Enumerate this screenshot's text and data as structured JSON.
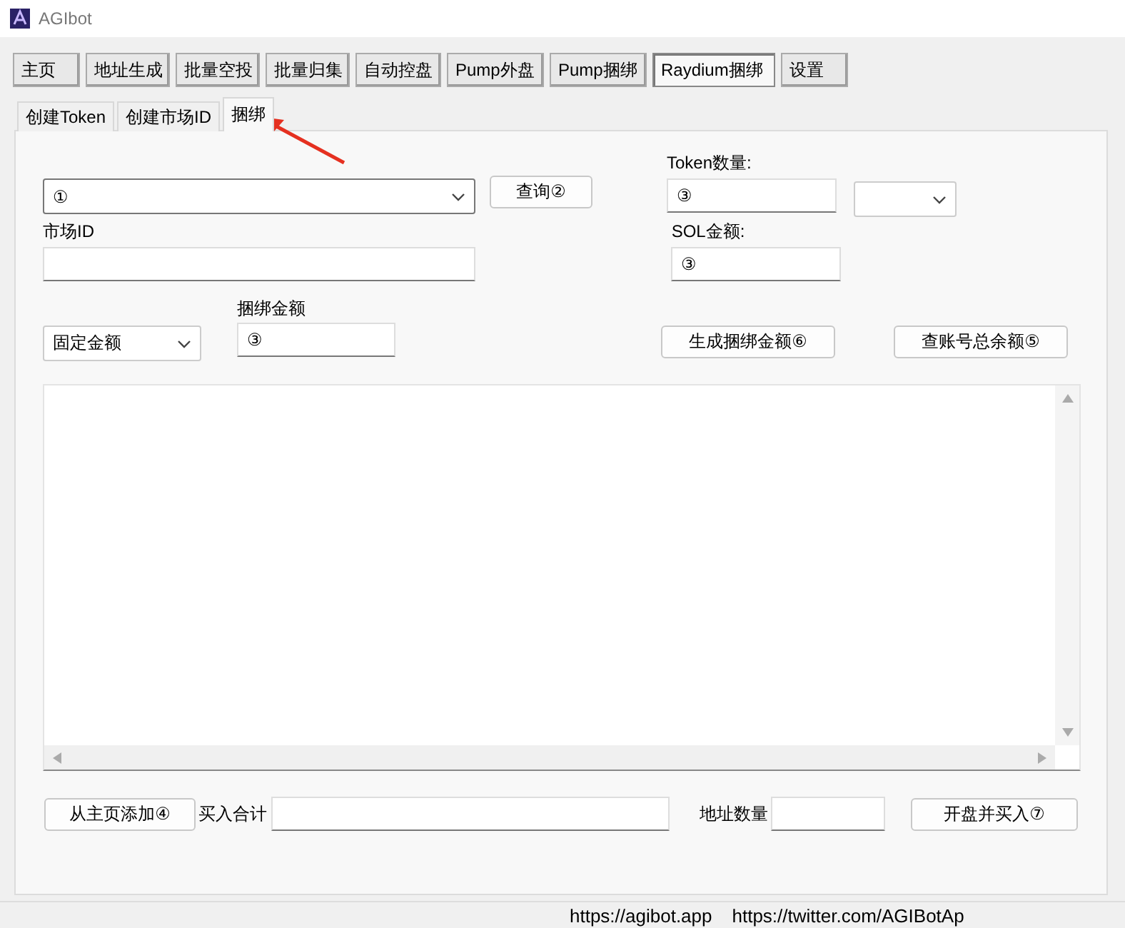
{
  "window": {
    "title": "AGIbot"
  },
  "main_tabs": [
    {
      "label": "主页",
      "selected": false
    },
    {
      "label": "地址生成",
      "selected": false
    },
    {
      "label": "批量空投",
      "selected": false
    },
    {
      "label": "批量归集",
      "selected": false
    },
    {
      "label": "自动控盘",
      "selected": false
    },
    {
      "label": "Pump外盘",
      "selected": false
    },
    {
      "label": "Pump捆绑",
      "selected": false
    },
    {
      "label": "Raydium捆绑",
      "selected": true
    },
    {
      "label": "设置",
      "selected": false
    }
  ],
  "sub_tabs": [
    {
      "label": "创建Token",
      "selected": false
    },
    {
      "label": "创建市场ID",
      "selected": false
    },
    {
      "label": "捆绑",
      "selected": true
    }
  ],
  "form": {
    "token_select": {
      "value": "①"
    },
    "query_button": "查询②",
    "token_amount": {
      "label": "Token数量:",
      "value": "③"
    },
    "market_id": {
      "label": "市场ID"
    },
    "sol_amount": {
      "label": "SOL金额:",
      "value": "③"
    },
    "amount_mode": {
      "value": "固定金额"
    },
    "bundle_amount": {
      "label": "捆绑金额",
      "value": "③"
    },
    "generate_button": "生成捆绑金额⑥",
    "balance_button": "查账号总余额⑤"
  },
  "bottom": {
    "add_button": "从主页添加④",
    "total_label": "买入合计",
    "count_label": "地址数量",
    "launch_button": "开盘并买入⑦"
  },
  "status_bar": [
    "https://agibot.app",
    "https://twitter.com/AGIBotAp"
  ]
}
